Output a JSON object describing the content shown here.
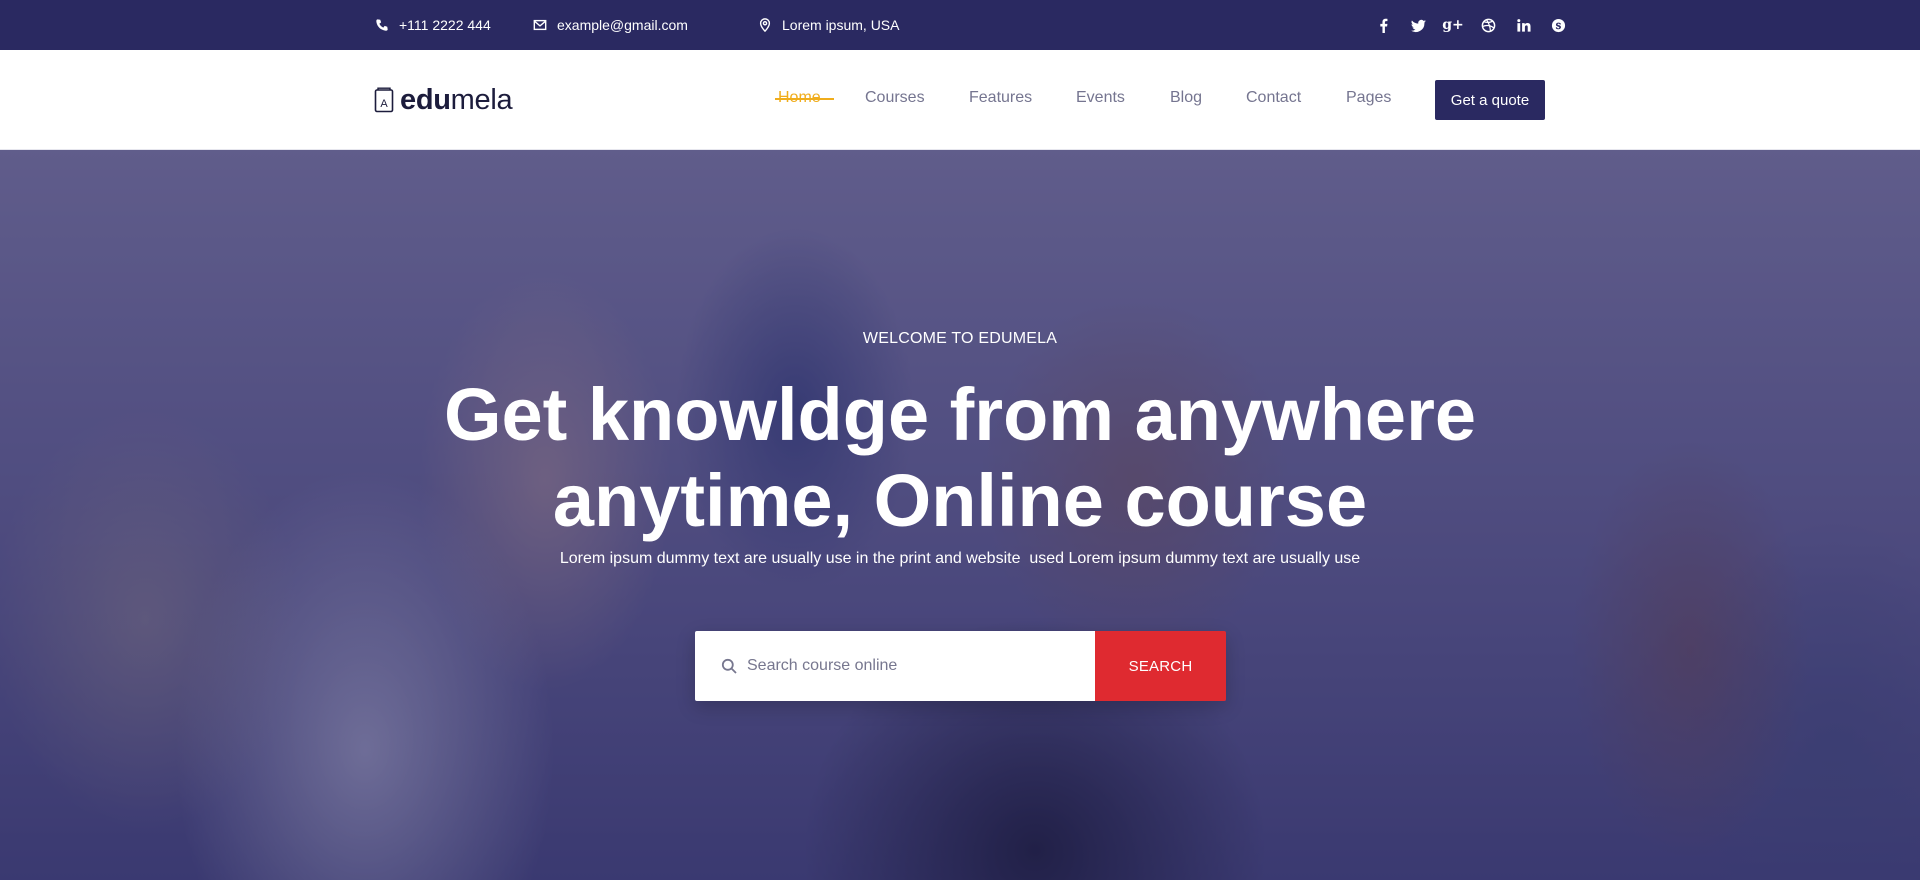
{
  "topbar": {
    "phone": "+111 2222 444",
    "email": "example@gmail.com",
    "location": "Lorem ipsum, USA",
    "social_icons": [
      "facebook-icon",
      "twitter-icon",
      "google-plus-icon",
      "dribbble-icon",
      "linkedin-icon",
      "skype-icon"
    ]
  },
  "header": {
    "logo_bold": "edu",
    "logo_rest": "mela",
    "nav": [
      {
        "label": "Home",
        "active": true
      },
      {
        "label": "Courses"
      },
      {
        "label": "Features"
      },
      {
        "label": "Events"
      },
      {
        "label": "Blog"
      },
      {
        "label": "Contact"
      },
      {
        "label": "Pages"
      }
    ],
    "cta_label": "Get a quote"
  },
  "hero": {
    "eyebrow": "WELCOME TO EDUMELA",
    "headline_line1": "Get knowldge from anywhere",
    "headline_line2": "anytime, Online course",
    "subline": "Lorem ipsum dummy text are usually use in the print and website  used Lorem ipsum dummy text are usually use",
    "search_placeholder": "Search course online",
    "search_button": "SEARCH"
  },
  "colors": {
    "brand_navy": "#2a2961",
    "accent_orange": "#f0ad1c",
    "search_red": "#df2a30"
  }
}
